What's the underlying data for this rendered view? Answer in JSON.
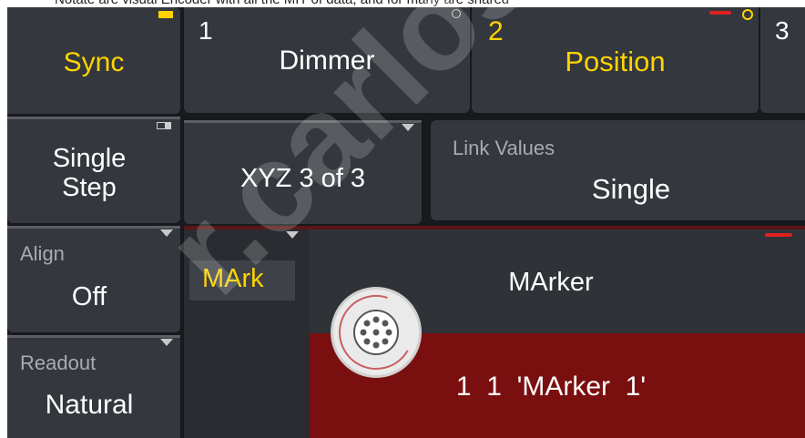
{
  "top_cut_text": "Notate are visual Encoder with all the MIT of data, and for many are shared",
  "sync": {
    "label": "Sync"
  },
  "single_step": {
    "line1": "Single",
    "line2": "Step"
  },
  "align": {
    "title": "Align",
    "value": "Off"
  },
  "readout": {
    "title": "Readout",
    "value": "Natural"
  },
  "tabs": [
    {
      "num": "1",
      "label": "Dimmer"
    },
    {
      "num": "2",
      "label": "Position"
    },
    {
      "num": "3",
      "label": ""
    }
  ],
  "xyz": {
    "label": "XYZ 3 of 3"
  },
  "link_values": {
    "title": "Link Values",
    "value": "Single"
  },
  "mark_tab": {
    "label": "MArk"
  },
  "marker": {
    "title": "MArker",
    "value": "1  1  'MArker  1'"
  },
  "watermark": {
    "text": "r.carlosme"
  },
  "colors": {
    "gold": "#ffd400",
    "dark_red": "#7a0f0f",
    "panel": "#34373d",
    "red_accent": "#e02020"
  }
}
